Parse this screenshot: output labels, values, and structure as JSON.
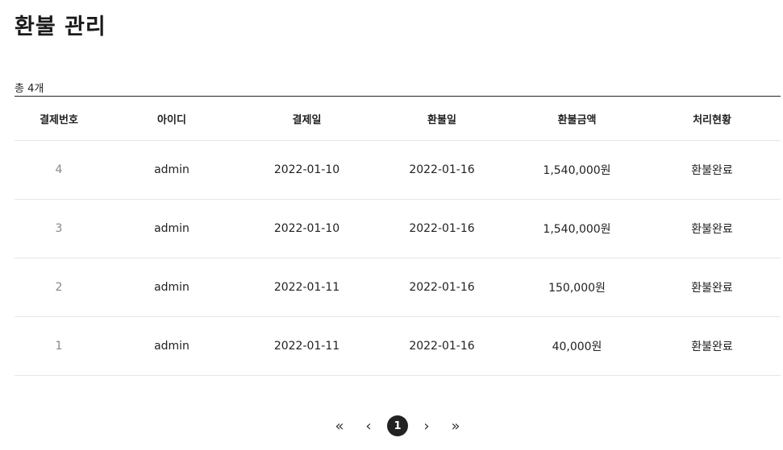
{
  "page": {
    "title": "환불 관리"
  },
  "summary": {
    "total": "총 4개"
  },
  "table": {
    "headers": [
      "결제번호",
      "아이디",
      "결제일",
      "환불일",
      "환불금액",
      "처리현황"
    ],
    "rows": [
      [
        "4",
        "admin",
        "2022-01-10",
        "2022-01-16",
        "1,540,000원",
        "환불완료"
      ],
      [
        "3",
        "admin",
        "2022-01-10",
        "2022-01-16",
        "1,540,000원",
        "환불완료"
      ],
      [
        "2",
        "admin",
        "2022-01-11",
        "2022-01-16",
        "150,000원",
        "환불완료"
      ],
      [
        "1",
        "admin",
        "2022-01-11",
        "2022-01-16",
        "40,000원",
        "환불완료"
      ]
    ]
  },
  "pagination": {
    "first_icon": "«",
    "prev_icon": "‹",
    "current_page": "1",
    "next_icon": "›",
    "last_icon": "»"
  }
}
